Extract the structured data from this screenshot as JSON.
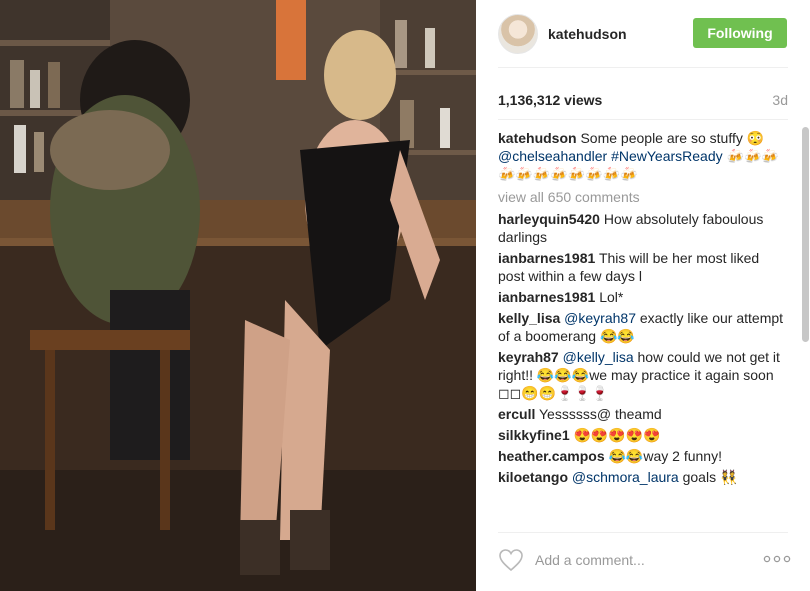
{
  "post": {
    "username": "katehudson",
    "follow_label": "Following",
    "views": "1,136,312 views",
    "age": "3d"
  },
  "caption": {
    "user": "katehudson",
    "text": "Some people are so stuffy 😳",
    "mention": "@chelseahandler",
    "hashtag": "#NewYearsReady",
    "emojis": "🍻🍻🍻🍻🍻🍻🍻🍻🍻🍻🍻"
  },
  "view_all": "view all 650 comments",
  "comments": [
    {
      "user": "harleyquin5420",
      "text": "How absolutely faboulous darlings"
    },
    {
      "user": "ianbarnes1981",
      "text": "This will be her most liked post within a few days l"
    },
    {
      "user": "ianbarnes1981",
      "text": "Lol*"
    },
    {
      "user": "kelly_lisa",
      "mention": "@keyrah87",
      "text": "exactly like our attempt of a boomerang 😂😂"
    },
    {
      "user": "keyrah87",
      "mention": "@kelly_lisa",
      "text": "how could we not get it right!! 😂😂😂we may practice it again soon ◻◻😁😁🍷🍷🍷"
    },
    {
      "user": "ercull",
      "text": "Yessssss@ theamd"
    },
    {
      "user": "silkkyfine1",
      "text": "😍😍😍😍😍"
    },
    {
      "user": "heather.campos",
      "text": "😂😂way 2 funny!"
    },
    {
      "user": "kiloetango",
      "mention": "@schmora_laura",
      "text": "goals 👯"
    }
  ],
  "input": {
    "placeholder": "Add a comment..."
  },
  "icons": {
    "like": "heart-icon",
    "options": "more-options-icon"
  },
  "colors": {
    "follow_button": "#70c050",
    "link": "#003569",
    "muted": "#999999"
  }
}
